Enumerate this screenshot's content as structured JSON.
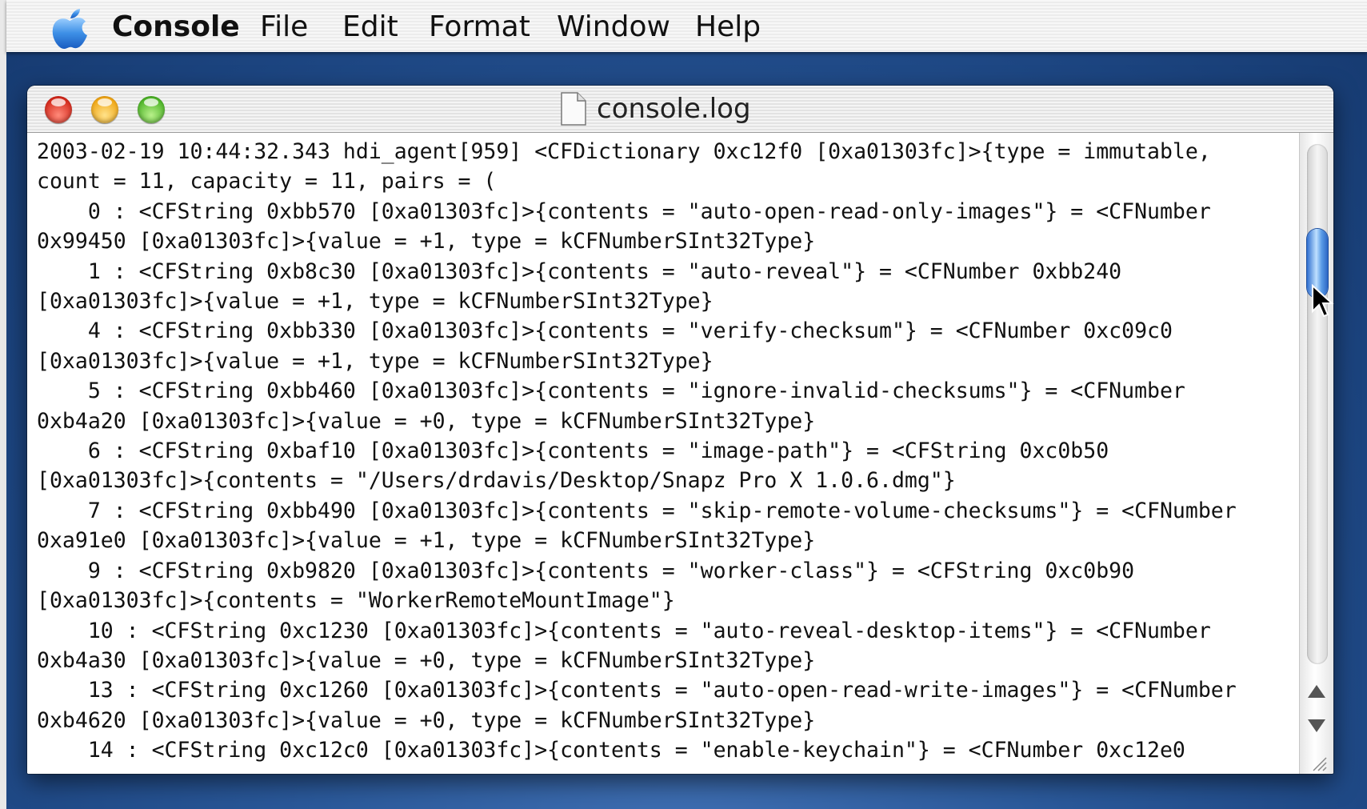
{
  "menubar": {
    "app_name": "Console",
    "items": [
      "File",
      "Edit",
      "Format",
      "Window",
      "Help"
    ]
  },
  "window": {
    "title": "console.log"
  },
  "log_lines": [
    "2003-02-19 10:44:32.343 hdi_agent[959] <CFDictionary 0xc12f0 [0xa01303fc]>{type = immutable,",
    "count = 11, capacity = 11, pairs = (",
    "\t0 : <CFString 0xbb570 [0xa01303fc]>{contents = \"auto-open-read-only-images\"} = <CFNumber",
    "0x99450 [0xa01303fc]>{value = +1, type = kCFNumberSInt32Type}",
    "\t1 : <CFString 0xb8c30 [0xa01303fc]>{contents = \"auto-reveal\"} = <CFNumber 0xbb240",
    "[0xa01303fc]>{value = +1, type = kCFNumberSInt32Type}",
    "\t4 : <CFString 0xbb330 [0xa01303fc]>{contents = \"verify-checksum\"} = <CFNumber 0xc09c0",
    "[0xa01303fc]>{value = +1, type = kCFNumberSInt32Type}",
    "\t5 : <CFString 0xbb460 [0xa01303fc]>{contents = \"ignore-invalid-checksums\"} = <CFNumber",
    "0xb4a20 [0xa01303fc]>{value = +0, type = kCFNumberSInt32Type}",
    "\t6 : <CFString 0xbaf10 [0xa01303fc]>{contents = \"image-path\"} = <CFString 0xc0b50",
    "[0xa01303fc]>{contents = \"/Users/drdavis/Desktop/Snapz Pro X 1.0.6.dmg\"}",
    "\t7 : <CFString 0xbb490 [0xa01303fc]>{contents = \"skip-remote-volume-checksums\"} = <CFNumber",
    "0xa91e0 [0xa01303fc]>{value = +1, type = kCFNumberSInt32Type}",
    "\t9 : <CFString 0xb9820 [0xa01303fc]>{contents = \"worker-class\"} = <CFString 0xc0b90",
    "[0xa01303fc]>{contents = \"WorkerRemoteMountImage\"}",
    "\t10 : <CFString 0xc1230 [0xa01303fc]>{contents = \"auto-reveal-desktop-items\"} = <CFNumber",
    "0xb4a30 [0xa01303fc]>{value = +0, type = kCFNumberSInt32Type}",
    "\t13 : <CFString 0xc1260 [0xa01303fc]>{contents = \"auto-open-read-write-images\"} = <CFNumber",
    "0xb4620 [0xa01303fc]>{value = +0, type = kCFNumberSInt32Type}",
    "\t14 : <CFString 0xc12c0 [0xa01303fc]>{contents = \"enable-keychain\"} = <CFNumber 0xc12e0"
  ]
}
